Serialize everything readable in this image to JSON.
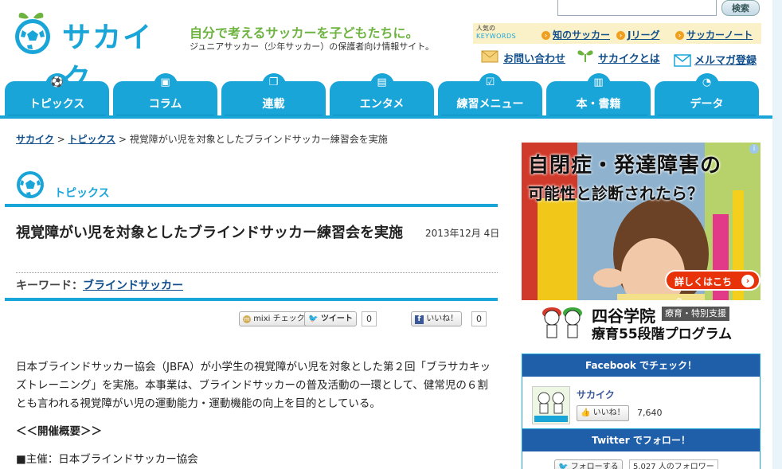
{
  "header": {
    "logo_text": "サカイク",
    "tagline": "自分で考えるサッカーを子どもたちに。",
    "subtagline": "ジュニアサッカー（少年サッカー）の保護者向け情報サイト。",
    "search": {
      "placeholder": "",
      "button_label": "検索"
    },
    "keywords": {
      "label_line1": "人気の",
      "label_line2": "KEYWORDS",
      "items": [
        "知のサッカー",
        "Jリーグ",
        "サッカーノート"
      ]
    },
    "util_links": {
      "contact": "お問い合わせ",
      "about": "サカイクとは",
      "newsletter": "メルマガ登録"
    }
  },
  "nav": {
    "tabs": [
      {
        "label": "トピックス",
        "icon": "⚽"
      },
      {
        "label": "コラム",
        "icon": "▣"
      },
      {
        "label": "連載",
        "icon": "❐"
      },
      {
        "label": "エンタメ",
        "icon": "▤"
      },
      {
        "label": "練習メニュー",
        "icon": "☑"
      },
      {
        "label": "本・書籍",
        "icon": "▥"
      },
      {
        "label": "データ",
        "icon": "◔"
      }
    ]
  },
  "breadcrumb": {
    "home": "サカイク",
    "sep1": " > ",
    "section": "トピックス",
    "sep2": " > ",
    "current": "視覚障がい児を対象としたブラインドサッカー練習会を実施"
  },
  "section_title": "トピックス",
  "article": {
    "title": "視覚障がい児を対象としたブラインドサッカー練習会を実施",
    "date": "2013年12月 4日",
    "keyword_label": "キーワード：",
    "keyword": "ブラインドサッカー",
    "sns": {
      "mixi": "mixi チェック",
      "tweet": "ツイート",
      "tweet_count": "0",
      "like": "いいね！",
      "like_count": "0"
    },
    "body_p1": "日本ブラインドサッカー協会（JBFA）が小学生の視覚障がい児を対象とした第２回「ブラサカキッズトレーニング」を実施。本事業は、ブラインドサッカーの普及活動の一環として、健常児の６割とも言われる視覚障がい児の運動能力・運動機能の向上を目的としている。",
    "body_heading": "＜＜開催概要＞＞",
    "body_p2": "■主催：日本ブラインドサッカー協会"
  },
  "ad": {
    "headline1": "自閉症・発達障害の",
    "headline2": "可能性と診断されたら？",
    "cta": "詳しくはこちら",
    "school": "四谷学院",
    "tag": "療育・特別支援",
    "program": "療育55段階プログラム"
  },
  "facebook": {
    "heading": "Facebook でチェック！",
    "page_name": "サカイク",
    "like_label": "いいね！",
    "like_count": "7,640"
  },
  "twitter": {
    "heading": "Twitter でフォロー！",
    "follow_label": "フォローする",
    "follower_count": "5,027 人のフォロワー"
  },
  "colors": {
    "brand_blue": "#1aa5d8",
    "tagline_green": "#6db33f",
    "link_navy": "#114f8c",
    "panel_navy": "#1f5ea8"
  }
}
